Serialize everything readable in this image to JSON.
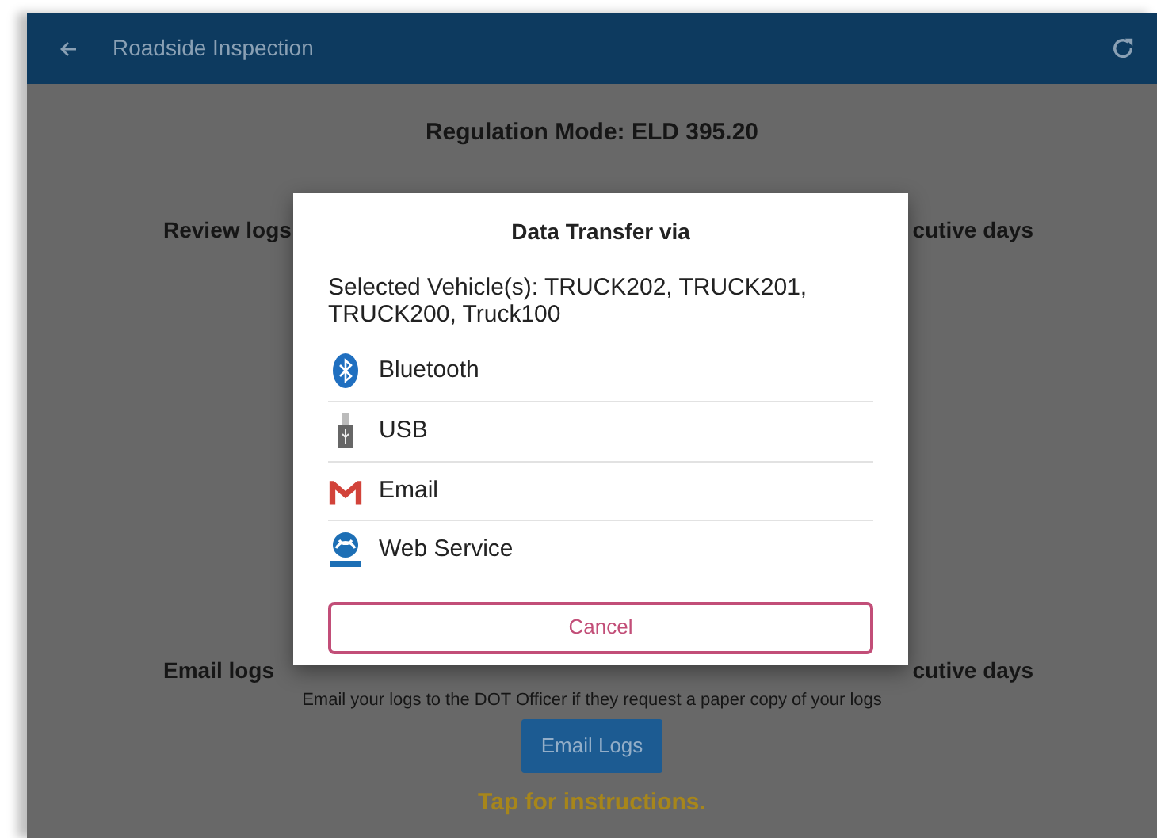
{
  "app_bar": {
    "title": "Roadside Inspection"
  },
  "regulation_mode": "Regulation Mode: ELD 395.20",
  "review_row": {
    "left": "Review logs",
    "right": "cutive days"
  },
  "email_row": {
    "left": "Email logs",
    "right": "cutive days"
  },
  "email_hint": "Email your logs to the DOT Officer if they request a paper copy of your logs",
  "email_button": "Email Logs",
  "instructions_link": "Tap for instructions.",
  "dialog": {
    "title": "Data Transfer via",
    "selected_vehicles": "Selected Vehicle(s): TRUCK202, TRUCK201, TRUCK200, Truck100",
    "options": [
      {
        "kind": "bluetooth",
        "label": "Bluetooth"
      },
      {
        "kind": "usb",
        "label": "USB"
      },
      {
        "kind": "email",
        "label": "Email"
      },
      {
        "kind": "web",
        "label": "Web Service"
      }
    ],
    "cancel": "Cancel"
  }
}
